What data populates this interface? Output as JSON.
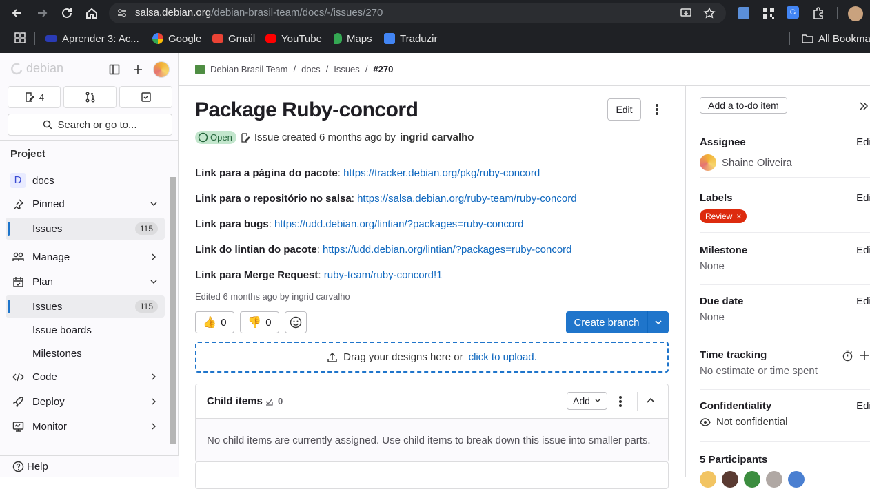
{
  "browser": {
    "url_host": "salsa.debian.org",
    "url_path": "/debian-brasil-team/docs/-/issues/270",
    "bookmarks": [
      {
        "label": "Aprender 3: Ac...",
        "icon": "flag-icon"
      },
      {
        "label": "Google",
        "icon": "google-icon"
      },
      {
        "label": "Gmail",
        "icon": "gmail-icon"
      },
      {
        "label": "YouTube",
        "icon": "youtube-icon"
      },
      {
        "label": "Maps",
        "icon": "maps-icon"
      },
      {
        "label": "Traduzir",
        "icon": "translate-icon"
      }
    ],
    "all_bookmarks": "All Bookma"
  },
  "sidebar": {
    "brand": "debian",
    "counts": {
      "issues_todo": "4"
    },
    "search_placeholder": "Search or go to...",
    "section_title": "Project",
    "project_avatar": "D",
    "project_name": "docs",
    "items": [
      {
        "label": "Pinned"
      },
      {
        "label": "Issues",
        "count": "115"
      },
      {
        "label": "Manage"
      },
      {
        "label": "Plan"
      },
      {
        "label": "Issues",
        "count": "115"
      },
      {
        "label": "Issue boards"
      },
      {
        "label": "Milestones"
      },
      {
        "label": "Code"
      },
      {
        "label": "Deploy"
      },
      {
        "label": "Monitor"
      }
    ],
    "help": "Help"
  },
  "breadcrumb": [
    "Debian Brasil Team",
    "docs",
    "Issues",
    "#270"
  ],
  "issue": {
    "title": "Package Ruby-concord",
    "edit_label": "Edit",
    "status": "Open",
    "created_text": "Issue created 6 months ago by",
    "author": "ingrid carvalho",
    "description": [
      {
        "label": "Link para a página do pacote",
        "link": "https://tracker.debian.org/pkg/ruby-concord"
      },
      {
        "label": "Link para o repositório no salsa",
        "link": "https://salsa.debian.org/ruby-team/ruby-concord"
      },
      {
        "label": "Link para bugs",
        "link": "https://udd.debian.org/lintian/?packages=ruby-concord"
      },
      {
        "label": "Link do lintian do pacote",
        "link": "https://udd.debian.org/lintian/?packages=ruby-concord"
      },
      {
        "label": "Link para Merge Request",
        "link": "ruby-team/ruby-concord!1"
      }
    ],
    "edited": "Edited 6 months ago by ingrid carvalho",
    "thumbs_up": "0",
    "thumbs_down": "0",
    "create_branch": "Create branch",
    "drop_text": "Drag your designs here or",
    "drop_link": "click to upload.",
    "child_items_title": "Child items",
    "child_items_count": "0",
    "add_label": "Add",
    "child_items_empty": "No child items are currently assigned. Use child items to break down this issue into smaller parts."
  },
  "right_sidebar": {
    "todo": "Add a to-do item",
    "edit": "Edit",
    "assignee_title": "Assignee",
    "assignee": "Shaine Oliveira",
    "labels_title": "Labels",
    "label": "Review",
    "label_color": "#dd2b0e",
    "milestone_title": "Milestone",
    "milestone": "None",
    "due_title": "Due date",
    "due": "None",
    "time_title": "Time tracking",
    "time": "No estimate or time spent",
    "conf_title": "Confidentiality",
    "conf": "Not confidential",
    "participants": "5 Participants"
  }
}
